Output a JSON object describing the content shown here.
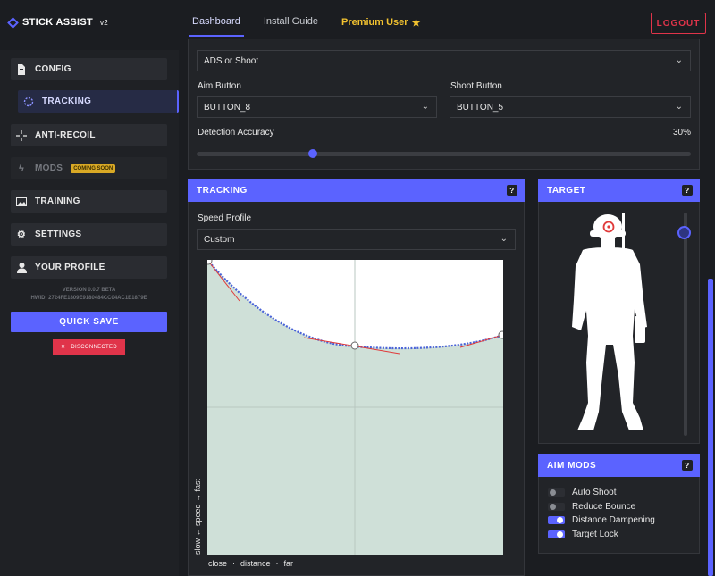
{
  "brand": {
    "name": "STICK ASSIST",
    "version": "v2"
  },
  "nav": {
    "dashboard": "Dashboard",
    "install_guide": "Install Guide",
    "premium": "Premium User",
    "premium_icon": "star-icon"
  },
  "header": {
    "logout": "LOGOUT"
  },
  "sidebar": {
    "items": [
      {
        "label": "CONFIG",
        "icon": "document-icon"
      },
      {
        "label": "TRACKING",
        "icon": "spinner-icon"
      },
      {
        "label": "ANTI-RECOIL",
        "icon": "crosshair-icon"
      },
      {
        "label": "MODS",
        "icon": "bolt-icon",
        "badge": "COMING SOON"
      },
      {
        "label": "TRAINING",
        "icon": "image-icon"
      },
      {
        "label": "SETTINGS",
        "icon": "gear-icon"
      },
      {
        "label": "YOUR PROFILE",
        "icon": "user-icon"
      }
    ],
    "version": "VERSION 0.0.7 BETA",
    "hwid": "HWID: 2724FE1809E9180484CC04AC1E1879E",
    "quick_save": "QUICK SAVE",
    "status": "DISCONNECTED"
  },
  "config": {
    "mode_value": "ADS or Shoot",
    "aim_button_label": "Aim Button",
    "aim_button_value": "BUTTON_8",
    "shoot_button_label": "Shoot Button",
    "shoot_button_value": "BUTTON_5",
    "detection_label": "Detection Accuracy",
    "detection_value": "30%",
    "detection_fraction": 0.235
  },
  "tracking": {
    "title": "TRACKING",
    "speed_profile_label": "Speed Profile",
    "speed_profile_value": "Custom",
    "y_axis_label": "slow ← speed → fast",
    "x_axis": [
      "close",
      "distance",
      "far"
    ]
  },
  "target": {
    "title": "TARGET",
    "slider_fraction": 0.07
  },
  "aim_mods": {
    "title": "AIM MODS",
    "items": [
      {
        "label": "Auto Shoot",
        "on": false
      },
      {
        "label": "Reduce Bounce",
        "on": false
      },
      {
        "label": "Distance Dampening",
        "on": true
      },
      {
        "label": "Target Lock",
        "on": true
      }
    ]
  },
  "colors": {
    "accent": "#5b63ff",
    "danger": "#e0344a",
    "premium": "#f2c230",
    "curve_fill": "#cfe0d8"
  }
}
